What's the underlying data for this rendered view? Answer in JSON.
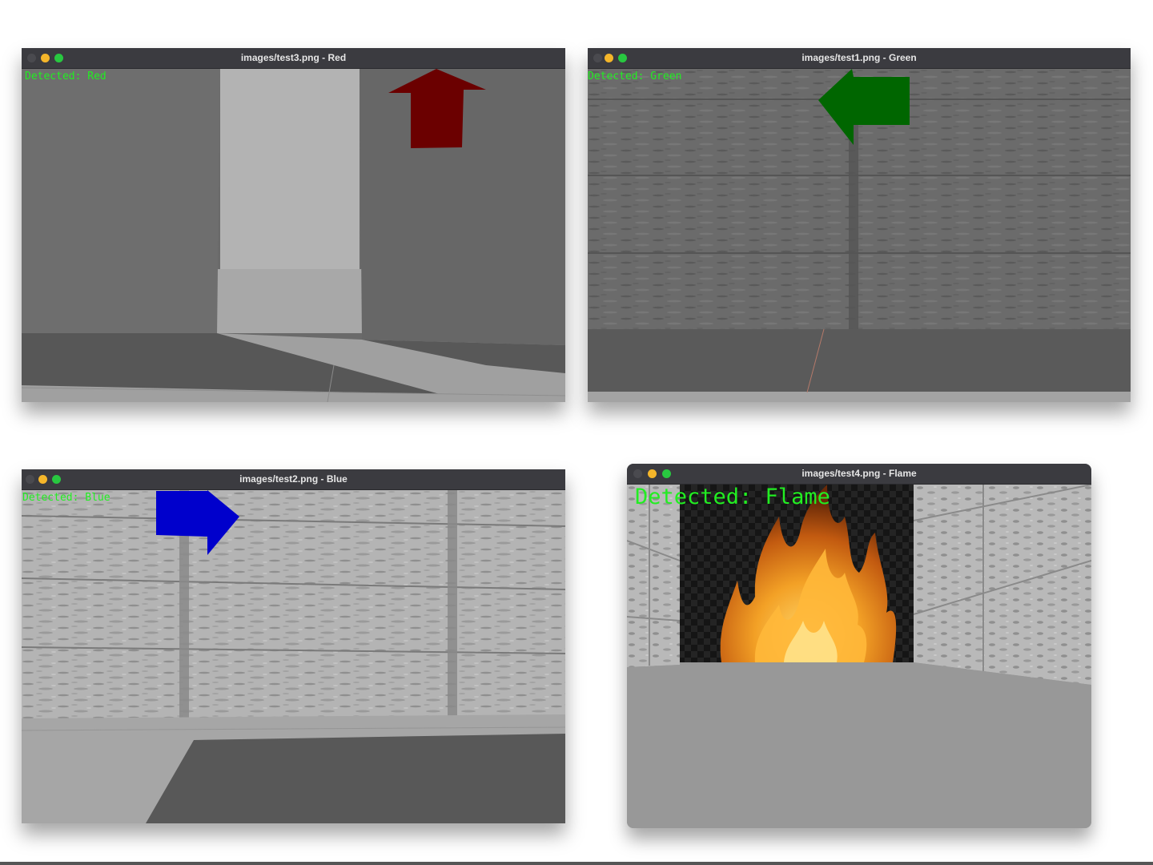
{
  "windows": [
    {
      "id": "red",
      "title": "images/test3.png - Red",
      "detection": "Detected: Red",
      "arrow_color": "#6b0000",
      "arrow_direction": "up"
    },
    {
      "id": "green",
      "title": "images/test1.png - Green",
      "detection": "Detected: Green",
      "arrow_color": "#006600",
      "arrow_direction": "left"
    },
    {
      "id": "blue",
      "title": "images/test2.png - Blue",
      "detection": "Detected: Blue",
      "arrow_color": "#0000cc",
      "arrow_direction": "right"
    },
    {
      "id": "flame",
      "title": "images/test4.png - Flame",
      "detection": "Detected: Flame"
    }
  ],
  "colors": {
    "close": "#4a4a4f",
    "minimize": "#f5b62a",
    "zoom": "#28c840",
    "overlay_text": "#22ee22"
  }
}
